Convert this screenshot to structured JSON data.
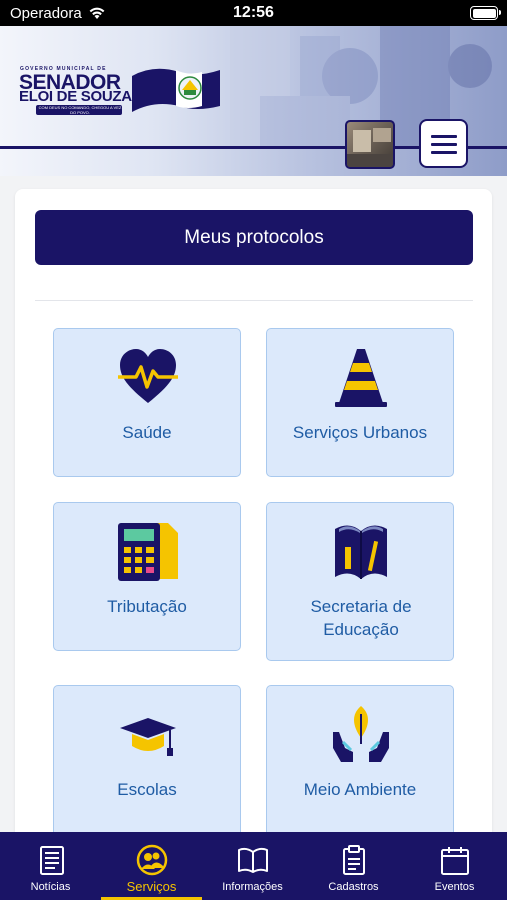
{
  "status_bar": {
    "carrier": "Operadora",
    "time": "12:56",
    "wifi_icon": "wifi-icon",
    "battery_icon": "battery-icon"
  },
  "header": {
    "logo": {
      "small_text": "GOVERNO MUNICIPAL DE",
      "name_line1": "SENADOR",
      "name_line2": "ELOI DE SOUZA",
      "slogan": "COM DEUS NO COMANDO, CHEGOU A VEZ DO POVO."
    },
    "menu_icon": "hamburger-icon"
  },
  "main": {
    "protocols_button": "Meus protocolos",
    "services": [
      {
        "label": "Saúde",
        "icon": "heart-pulse-icon"
      },
      {
        "label": "Serviços Urbanos",
        "icon": "traffic-cone-icon"
      },
      {
        "label": "Tributação",
        "icon": "calculator-icon"
      },
      {
        "label": "Secretaria de Educação",
        "icon": "book-icon"
      },
      {
        "label": "Escolas",
        "icon": "graduation-cap-icon"
      },
      {
        "label": "Meio Ambiente",
        "icon": "hands-leaf-icon"
      }
    ]
  },
  "tab_bar": {
    "active": "Serviços",
    "tabs": [
      {
        "label": "Notícias",
        "icon": "newspaper-icon"
      },
      {
        "label": "Serviços",
        "icon": "users-icon"
      },
      {
        "label": "Informações",
        "icon": "open-book-icon"
      },
      {
        "label": "Cadastros",
        "icon": "clipboard-icon"
      },
      {
        "label": "Eventos",
        "icon": "calendar-icon"
      }
    ]
  },
  "colors": {
    "navy": "#1a1466",
    "yellow": "#f5c400",
    "tile_bg": "#dce9fb",
    "tile_border": "#a9c9ee",
    "tile_text": "#1f5ca4"
  }
}
